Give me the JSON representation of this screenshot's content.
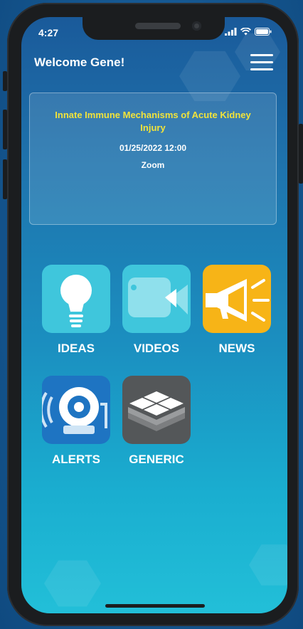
{
  "status_bar": {
    "time": "4:27"
  },
  "header": {
    "welcome": "Welcome Gene!"
  },
  "event_card": {
    "title": "Innate Immune Mechanisms of Acute Kidney Injury",
    "datetime": "01/25/2022 12:00",
    "location": "Zoom"
  },
  "tiles": [
    {
      "label": "IDEAS",
      "icon": "lightbulb-icon",
      "color": "#3fc6dc"
    },
    {
      "label": "VIDEOS",
      "icon": "video-camera-icon",
      "color": "#3fc6dc"
    },
    {
      "label": "NEWS",
      "icon": "megaphone-icon",
      "color": "#f7b417"
    },
    {
      "label": "ALERTS",
      "icon": "alarm-bell-icon",
      "color": "#1e74c2"
    },
    {
      "label": "GENERIC",
      "icon": "layers-icon",
      "color": "#545759"
    }
  ],
  "colors": {
    "title_yellow": "#f2e33a",
    "screen_top": "#1a5a9a",
    "screen_bottom": "#22bfd8"
  }
}
